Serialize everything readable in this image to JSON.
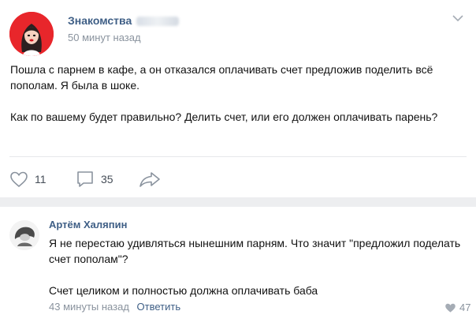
{
  "post": {
    "group_name": "Знакомства",
    "time": "50 минут назад",
    "paragraphs": [
      "Пошла с парнем в кафе, а он отказался оплачивать счет предложив поделить всё пополам. Я была в шоке.",
      "Как по вашему будет правильно? Делить счет, или его должен оплачивать парень?"
    ],
    "likes": "11",
    "comments": "35"
  },
  "comment": {
    "author": "Артём Халяпин",
    "paragraphs": [
      "Я не перестаю удивляться нынешним парням. Что значит \"предложил поделать счет пополам\"?",
      "Счет целиком и полностью должна оплачивать баба"
    ],
    "time": "43 минуты назад",
    "reply_label": "Ответить",
    "likes": "47"
  },
  "icons": {
    "heart": "heart-icon",
    "comment": "comment-icon",
    "share": "share-icon",
    "chevron": "chevron-down-icon",
    "comment_heart": "heart-icon"
  },
  "colors": {
    "link_blue": "#3f5f86",
    "meta_gray": "#8a939e",
    "avatar_red": "#e8262b",
    "separator": "#edeef0"
  }
}
